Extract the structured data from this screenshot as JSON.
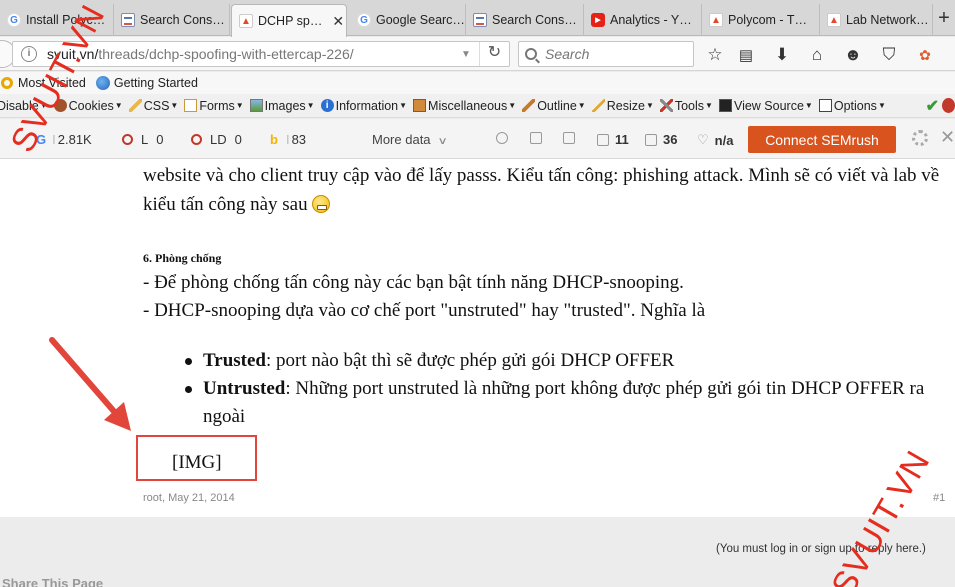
{
  "tabs": [
    {
      "label": "Install Polyc…",
      "icon": "google-icon",
      "active": false
    },
    {
      "label": "Search Cons…",
      "icon": "search-console-icon",
      "active": false
    },
    {
      "label": "DCHP sp…",
      "icon": "svuit-icon",
      "active": true
    },
    {
      "label": "Google Searc…",
      "icon": "google-icon",
      "active": false
    },
    {
      "label": "Search Cons…",
      "icon": "search-console-icon",
      "active": false
    },
    {
      "label": "Analytics - Y…",
      "icon": "youtube-icon",
      "active": false
    },
    {
      "label": "Polycom - T…",
      "icon": "svuit-icon",
      "active": false
    },
    {
      "label": "Lab Network…",
      "icon": "svuit-icon",
      "active": false
    }
  ],
  "nav": {
    "url_host": "svuit.vn/",
    "url_path": "threads/dchp-spoofing-with-ettercap-226/",
    "search_placeholder": "Search"
  },
  "bookmarks": [
    {
      "label": "Most Visited",
      "icon": "gear-icon"
    },
    {
      "label": "Getting Started",
      "icon": "globe-icon"
    }
  ],
  "devtoolbar": [
    {
      "label": "Disable",
      "icon": "stop-icon"
    },
    {
      "label": "Cookies",
      "icon": "cookie-icon"
    },
    {
      "label": "CSS",
      "icon": "pencil-icon"
    },
    {
      "label": "Forms",
      "icon": "form-icon"
    },
    {
      "label": "Images",
      "icon": "image-icon"
    },
    {
      "label": "Information",
      "icon": "info-icon"
    },
    {
      "label": "Miscellaneous",
      "icon": "misc-icon"
    },
    {
      "label": "Outline",
      "icon": "outline-icon"
    },
    {
      "label": "Resize",
      "icon": "resize-icon"
    },
    {
      "label": "Tools",
      "icon": "tools-icon"
    },
    {
      "label": "View Source",
      "icon": "source-icon"
    },
    {
      "label": "Options",
      "icon": "options-icon"
    }
  ],
  "seobar": {
    "google_index": "2.81K",
    "links": "0",
    "linking_domains": "0",
    "bing_index": "83",
    "more_data": "More data",
    "backlinks": "11",
    "pages": "36",
    "rank": "n/a",
    "connect_button": "Connect SEMrush"
  },
  "post": {
    "intro": "website và cho client truy cập vào để lấy passs. Kiểu tấn công: phishing attack. Mình sẽ có viết và lab về kiểu tấn công này sau",
    "section_heading": "6. Phòng chống",
    "line1": "- Để phòng chống tấn công này các bạn bật tính năng DHCP-snooping.",
    "line2": "- DHCP-snooping dựa vào cơ chế port \"unstruted\" hay \"trusted\". Nghĩa là",
    "bullets": [
      {
        "term": "Trusted",
        "text": ": port nào bật thì sẽ được phép gửi gói DHCP OFFER"
      },
      {
        "term": "Untrusted",
        "text": ": Những port unstruted là những port không được phép gửi gói tin DHCP OFFER ra ngoài"
      }
    ],
    "img_placeholder": "[IMG]",
    "byline": "root, May 21, 2014",
    "post_number": "#1"
  },
  "footer": {
    "login_note": "(You must log in or sign up to reply here.)",
    "share_title": "Share This Page"
  },
  "watermark": "SVUIT.VN",
  "colors": {
    "semrush": "#d9531e",
    "annotation_red": "#e2463a",
    "watermark_red": "#e52d1f"
  }
}
